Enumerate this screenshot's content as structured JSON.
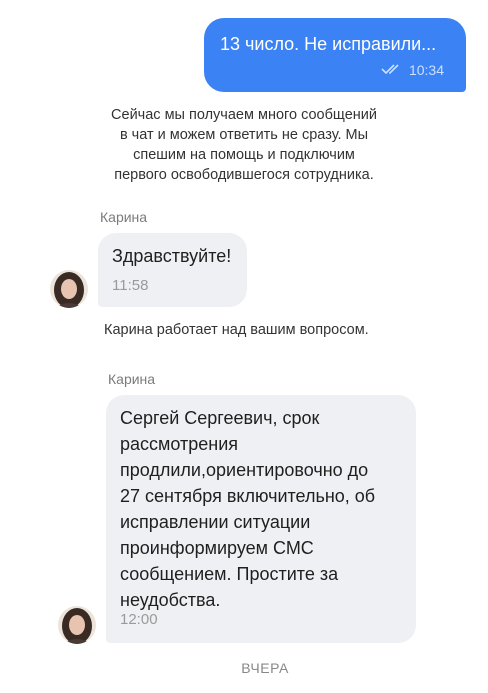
{
  "outgoing": {
    "text": "13 число. Не исправили...",
    "time": "10:34",
    "status_icon": "double-check-icon"
  },
  "system_notice": {
    "lines": [
      "Сейчас мы получаем много сообщений",
      "в чат и можем ответить не сразу. Мы",
      "спешим на помощь и подключим",
      "первого освободившегося сотрудника."
    ]
  },
  "message1": {
    "sender": "Карина",
    "text": "Здравствуйте!",
    "time": "11:58"
  },
  "status_notice": "Карина работает над вашим вопросом.",
  "message2": {
    "sender": "Карина",
    "lines": [
      "Сергей Сергеевич, срок",
      "рассмотрения",
      "продлили,ориентировочно до",
      "27 сентября включительно, об",
      "исправлении ситуации",
      "проинформируем СМС",
      "сообщением. Простите за",
      "неудобства."
    ],
    "time": "12:00"
  },
  "date_divider": "ВЧЕРА",
  "colors": {
    "outgoing_bubble": "#3b82f5",
    "incoming_bubble": "#eef0f3"
  }
}
